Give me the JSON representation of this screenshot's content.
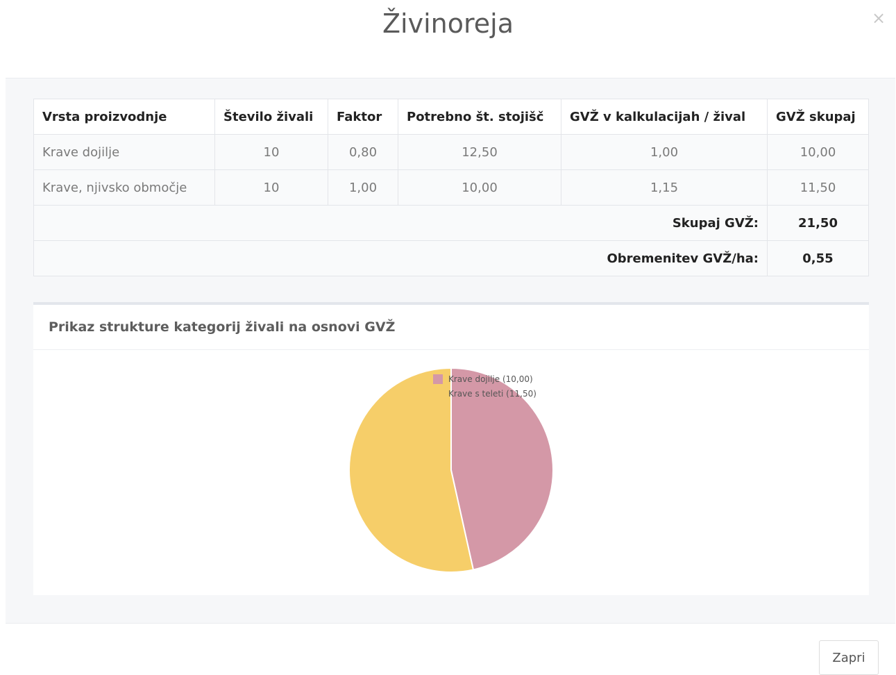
{
  "modal": {
    "title": "Živinoreja",
    "close_icon": "×",
    "close_button_label": "Zapri"
  },
  "table": {
    "headers": [
      "Vrsta proizvodnje",
      "Število živali",
      "Faktor",
      "Potrebno št. stojišč",
      "GVŽ v kalkulacijah / žival",
      "GVŽ skupaj"
    ],
    "rows": [
      [
        "Krave dojilje",
        "10",
        "0,80",
        "12,50",
        "1,00",
        "10,00"
      ],
      [
        "Krave, njivsko območje",
        "10",
        "1,00",
        "10,00",
        "1,15",
        "11,50"
      ]
    ],
    "totals": [
      {
        "label": "Skupaj GVŽ:",
        "value": "21,50"
      },
      {
        "label": "Obremenitev GVŽ/ha:",
        "value": "0,55"
      }
    ]
  },
  "chart_panel": {
    "heading": "Prikaz strukture kategorij živali na osnovi GVŽ"
  },
  "chart_data": {
    "type": "pie",
    "title": "",
    "legend_position": "top-right",
    "slices": [
      {
        "label": "Krave dojilje (10,00)",
        "value": 10.0,
        "color": "#d498a7"
      },
      {
        "label": "Krave s teleti (11,50)",
        "value": 11.5,
        "color": "#f6ce69"
      }
    ]
  }
}
